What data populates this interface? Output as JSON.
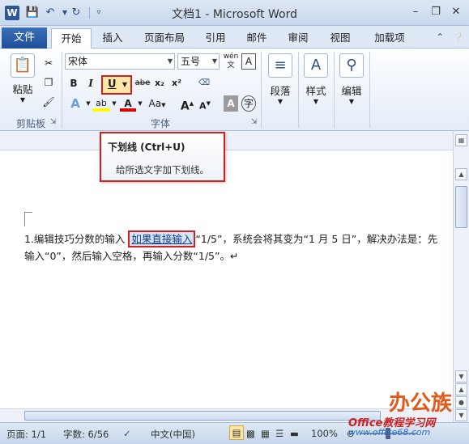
{
  "window": {
    "title": "文档1 - Microsoft Word",
    "app_icon": "W"
  },
  "tabs": {
    "file": "文件",
    "items": [
      "开始",
      "插入",
      "页面布局",
      "引用",
      "邮件",
      "审阅",
      "视图",
      "加载项"
    ],
    "active_index": 0
  },
  "ribbon": {
    "clipboard": {
      "paste_label": "粘贴",
      "group_label": "剪贴板"
    },
    "font": {
      "font_name": "宋体",
      "font_size": "五号",
      "wen_label": "wén",
      "bold": "B",
      "italic": "I",
      "underline": "U",
      "strikethrough": "abe",
      "subscript": "x₂",
      "superscript": "x²",
      "change_case": "Aa",
      "grow_font": "A",
      "shrink_font": "A",
      "group_label": "字体"
    },
    "paragraph": {
      "label": "段落"
    },
    "styles": {
      "label": "样式"
    },
    "editing": {
      "label": "编辑"
    }
  },
  "tooltip": {
    "title": "下划线 (Ctrl+U)",
    "description": "给所选文字加下划线。"
  },
  "document": {
    "line1_prefix": "1.编辑技巧分数的输入 ",
    "line1_highlight": "如果直接输入",
    "line1_suffix": "“1/5”，系统会将其变为“1 月 5 日”，解决办法是：先",
    "line2": "输入“0”，然后输入空格，再输入分数“1/5”。↵"
  },
  "status": {
    "page": "页面: 1/1",
    "words": "字数: 6/56",
    "language": "中文(中国)",
    "zoom": "100%"
  },
  "watermark": {
    "brand": "办公族",
    "site_cn": "Office教程学习网",
    "url": "www.office68.com"
  },
  "colors": {
    "accent": "#2b5797",
    "highlight_border": "#d12020",
    "underline_active": "#fde7a8"
  }
}
